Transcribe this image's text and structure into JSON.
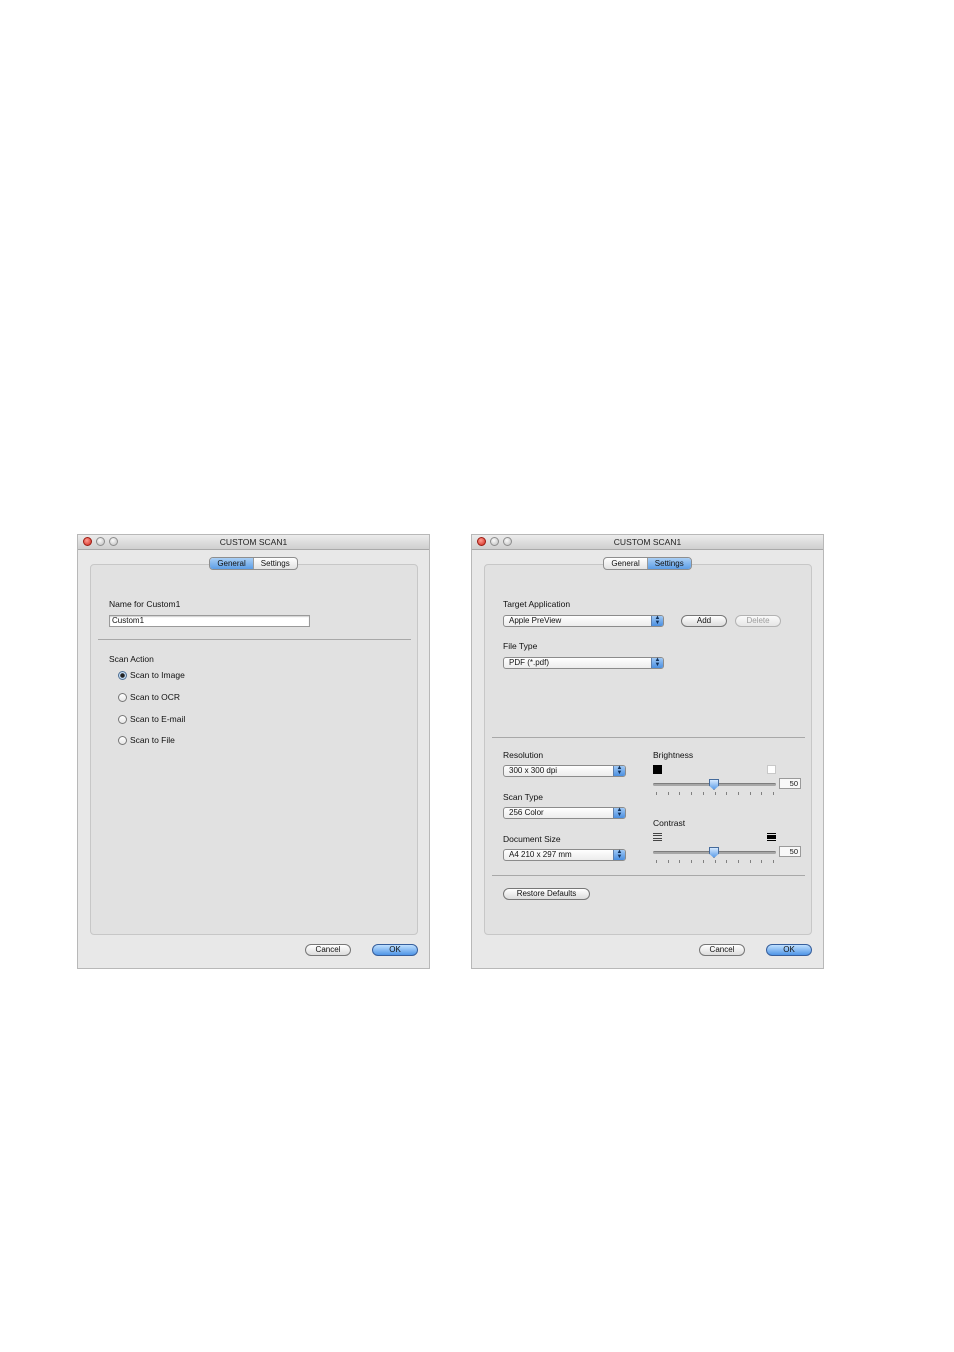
{
  "left_window": {
    "title": "CUSTOM SCAN1",
    "tabs": [
      "General",
      "Settings"
    ],
    "active_tab": "General",
    "name_label": "Name for Custom1",
    "name_value": "Custom1",
    "scan_action_label": "Scan Action",
    "scan_actions": [
      "Scan to Image",
      "Scan to OCR",
      "Scan to E-mail",
      "Scan to File"
    ],
    "selected_action": "Scan to Image",
    "cancel_label": "Cancel",
    "ok_label": "OK"
  },
  "right_window": {
    "title": "CUSTOM SCAN1",
    "tabs": [
      "General",
      "Settings"
    ],
    "active_tab": "Settings",
    "target_app_label": "Target Application",
    "target_app_value": "Apple PreView",
    "add_label": "Add",
    "delete_label": "Delete",
    "file_type_label": "File Type",
    "file_type_value": "PDF (*.pdf)",
    "resolution_label": "Resolution",
    "resolution_value": "300 x 300 dpi",
    "scan_type_label": "Scan Type",
    "scan_type_value": "256 Color",
    "document_size_label": "Document Size",
    "document_size_value": "A4 210 x 297 mm",
    "brightness_label": "Brightness",
    "brightness_value": "50",
    "contrast_label": "Contrast",
    "contrast_value": "50",
    "restore_label": "Restore Defaults",
    "cancel_label": "Cancel",
    "ok_label": "OK"
  },
  "icons": {
    "close": "close-icon",
    "minimize": "minimize-icon",
    "zoom": "zoom-icon",
    "popup_arrows": "updown-arrows-icon",
    "brightness_low": "black-square-icon",
    "brightness_high": "white-square-icon",
    "contrast_low": "low-contrast-lines-icon",
    "contrast_high": "high-contrast-lines-icon"
  },
  "colors": {
    "accent": "#5d9ee6",
    "window_bg": "#e8e8e8",
    "close_button": "#d2281c"
  }
}
